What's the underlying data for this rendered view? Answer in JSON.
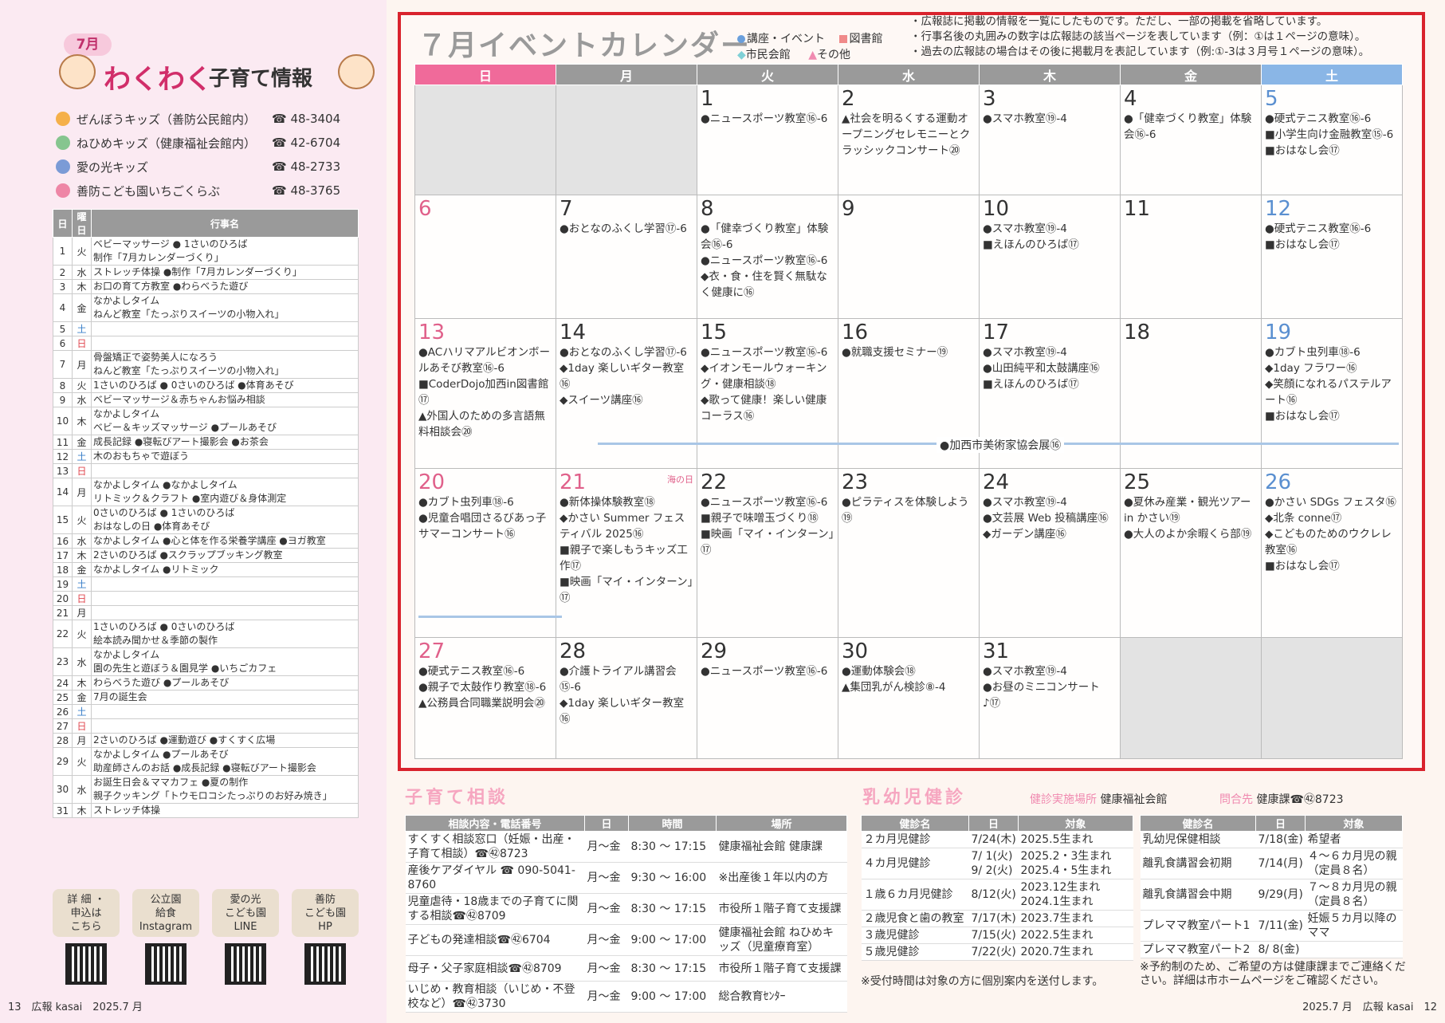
{
  "left": {
    "month_tag": "7月",
    "title_a": "わくわく",
    "title_b": "子育て情報",
    "contacts": [
      {
        "name": "ぜんぼうキッズ（善防公民館内）",
        "phone": "☎ 48-3404",
        "color": "#f5b04a"
      },
      {
        "name": "ねひめキッズ（健康福祉会館内）",
        "phone": "☎ 42-6704",
        "color": "#86c58f"
      },
      {
        "name": "愛の光キッズ",
        "phone": "☎ 48-2733",
        "color": "#7b9bd6"
      },
      {
        "name": "善防こども園いちごくらぶ",
        "phone": "☎ 48-3765",
        "color": "#ee86a6"
      }
    ],
    "schedule_headers": [
      "日",
      "曜日",
      "行事名"
    ],
    "schedule": [
      {
        "d": "1",
        "w": "火",
        "e": [
          "ベビーマッサージ ● 1さいのひろば",
          "制作「7月カレンダーづくり」"
        ]
      },
      {
        "d": "2",
        "w": "水",
        "e": [
          "ストレッチ体操 ●制作「7月カレンダーづくり」"
        ]
      },
      {
        "d": "3",
        "w": "木",
        "e": [
          "お口の育て方教室 ●わらべうた遊び"
        ]
      },
      {
        "d": "4",
        "w": "金",
        "e": [
          "なかよしタイム",
          "ねんど教室「たっぷりスイーツの小物入れ」"
        ]
      },
      {
        "d": "5",
        "w": "土",
        "e": []
      },
      {
        "d": "6",
        "w": "日",
        "e": []
      },
      {
        "d": "7",
        "w": "月",
        "e": [
          "骨盤矯正で姿勢美人になろう",
          "ねんど教室「たっぷりスイーツの小物入れ」"
        ]
      },
      {
        "d": "8",
        "w": "火",
        "e": [
          "1さいのひろば ● 0さいのひろば ●体育あそび"
        ]
      },
      {
        "d": "9",
        "w": "水",
        "e": [
          "ベビーマッサージ＆赤ちゃんお悩み相談"
        ]
      },
      {
        "d": "10",
        "w": "木",
        "e": [
          "なかよしタイム",
          "ベビー＆キッズマッサージ ●プールあそび"
        ]
      },
      {
        "d": "11",
        "w": "金",
        "e": [
          "成長記録 ●寝転びアート撮影会 ●お茶会"
        ]
      },
      {
        "d": "12",
        "w": "土",
        "e": [
          "木のおもちゃで遊ぼう"
        ]
      },
      {
        "d": "13",
        "w": "日",
        "e": []
      },
      {
        "d": "14",
        "w": "月",
        "e": [
          "なかよしタイム ●なかよしタイム",
          "リトミック＆クラフト ●室内遊び＆身体測定"
        ]
      },
      {
        "d": "15",
        "w": "火",
        "e": [
          "0さいのひろば ● 1さいのひろば",
          "おはなしの日 ●体育あそび"
        ]
      },
      {
        "d": "16",
        "w": "水",
        "e": [
          "なかよしタイム ●心と体を作る栄養学講座 ●ヨガ教室"
        ]
      },
      {
        "d": "17",
        "w": "木",
        "e": [
          "2さいのひろば ●スクラップブッキング教室"
        ]
      },
      {
        "d": "18",
        "w": "金",
        "e": [
          "なかよしタイム ●リトミック"
        ]
      },
      {
        "d": "19",
        "w": "土",
        "e": []
      },
      {
        "d": "20",
        "w": "日",
        "e": []
      },
      {
        "d": "21",
        "w": "月",
        "e": []
      },
      {
        "d": "22",
        "w": "火",
        "e": [
          "1さいのひろば ● 0さいのひろば",
          "絵本読み聞かせ＆季節の製作"
        ]
      },
      {
        "d": "23",
        "w": "水",
        "e": [
          "なかよしタイム",
          "園の先生と遊ぼう＆園見学 ●いちごカフェ"
        ]
      },
      {
        "d": "24",
        "w": "木",
        "e": [
          "わらべうた遊び ●プールあそび"
        ]
      },
      {
        "d": "25",
        "w": "金",
        "e": [
          "7月の誕生会"
        ]
      },
      {
        "d": "26",
        "w": "土",
        "e": []
      },
      {
        "d": "27",
        "w": "日",
        "e": []
      },
      {
        "d": "28",
        "w": "月",
        "e": [
          "2さいのひろば ●運動遊び ●すくすく広場"
        ]
      },
      {
        "d": "29",
        "w": "火",
        "e": [
          "なかよしタイム ●プールあそび",
          "助産師さんのお話 ●成長記録 ●寝転びアート撮影会"
        ]
      },
      {
        "d": "30",
        "w": "水",
        "e": [
          "お誕生日会＆ママカフェ ●夏の制作",
          "親子クッキング「トウモロコシたっぷりのお好み焼き」"
        ]
      },
      {
        "d": "31",
        "w": "木",
        "e": [
          "ストレッチ体操"
        ]
      }
    ],
    "links": [
      "詳 細 ・\n申込は\nこちら",
      "公立園\n給食\nInstagram",
      "愛の光\nこども園\nLINE",
      "善防\nこども園\nHP"
    ],
    "footer": "13　広報 kasai　2025.7 月"
  },
  "calendar": {
    "title": "７月イベントカレンダー",
    "legend": [
      "講座・イベント",
      "市民会館",
      "図書館",
      "その他"
    ],
    "notes": [
      "・広報誌に掲載の情報を一覧にしたものです。ただし、一部の掲載を省略しています。",
      "・行事名後の丸囲みの数字は広報誌の該当ページを表しています（例：①は１ページの意味）。",
      "・過去の広報誌の場合はその後に掲載月を表記しています（例:①-3は３月号１ページの意味）。"
    ],
    "weekdays": [
      "日",
      "月",
      "火",
      "水",
      "木",
      "金",
      "土"
    ],
    "weeks": [
      [
        {
          "n": "",
          "g": true,
          "ev": []
        },
        {
          "n": "",
          "g": true,
          "ev": []
        },
        {
          "n": "1",
          "ev": [
            "●ニュースポーツ教室⑯-6"
          ]
        },
        {
          "n": "2",
          "ev": [
            "▲社会を明るくする運動オープニングセレモニーとクラッシックコンサート⑳"
          ]
        },
        {
          "n": "3",
          "ev": [
            "●スマホ教室⑲-4"
          ]
        },
        {
          "n": "4",
          "ev": [
            "●「健幸づくり教室」体験会⑯-6"
          ]
        },
        {
          "n": "5",
          "ev": [
            "●硬式テニス教室⑯-6",
            "■小学生向け金融教室⑮-6",
            "■おはなし会⑰"
          ]
        }
      ],
      [
        {
          "n": "6",
          "ev": []
        },
        {
          "n": "7",
          "ev": [
            "●おとなのふくし学習⑰-6"
          ]
        },
        {
          "n": "8",
          "ev": [
            "●「健幸づくり教室」体験会⑯-6",
            "●ニュースポーツ教室⑯-6",
            "◆衣・食・住を賢く無駄なく健康に⑯"
          ]
        },
        {
          "n": "9",
          "ev": []
        },
        {
          "n": "10",
          "ev": [
            "●スマホ教室⑲-4",
            "■えほんのひろば⑰"
          ]
        },
        {
          "n": "11",
          "ev": []
        },
        {
          "n": "12",
          "ev": [
            "●硬式テニス教室⑯-6",
            "■おはなし会⑰"
          ]
        }
      ],
      [
        {
          "n": "13",
          "ev": [
            "●ACハリマアルビオンボールあそび教室⑯-6",
            "■CoderDojo加西in図書館⑰",
            "▲外国人のための多言語無料相談会⑳"
          ]
        },
        {
          "n": "14",
          "ev": [
            "●おとなのふくし学習⑰-6",
            "◆1day 楽しいギター教室⑯",
            "◆スイーツ講座⑯"
          ]
        },
        {
          "n": "15",
          "ev": [
            "●ニュースポーツ教室⑯-6",
            "◆イオンモールウォーキング・健康相談⑱",
            "◆歌って健康！楽しい健康コーラス⑯"
          ]
        },
        {
          "n": "16",
          "ev": [
            "●就職支援セミナー⑲"
          ]
        },
        {
          "n": "17",
          "ev": [
            "●スマホ教室⑲-4",
            "●山田純平和太鼓講座⑯",
            "■えほんのひろば⑰"
          ]
        },
        {
          "n": "18",
          "ev": []
        },
        {
          "n": "19",
          "ev": [
            "●カブト虫列車⑱-6",
            "◆1day フラワー⑯",
            "◆笑顔になれるパステルアート⑯",
            "■おはなし会⑰"
          ]
        }
      ],
      [
        {
          "n": "20",
          "ev": [
            "●カブト虫列車⑱-6",
            "●児童合唱団さるびあっ子サマーコンサート⑯"
          ]
        },
        {
          "n": "21",
          "holiday": "海の日",
          "ev": [
            "●新体操体験教室⑱",
            "◆かさい Summer フェスティバル 2025⑯",
            "■親子で楽しもうキッズ工作⑰",
            "■映画「マイ・インターン」⑰"
          ]
        },
        {
          "n": "22",
          "ev": [
            "●ニュースポーツ教室⑯-6",
            "■親子で味噌玉づくり⑱",
            "■映画「マイ・インターン」⑰"
          ]
        },
        {
          "n": "23",
          "ev": [
            "●ピラティスを体験しよう⑲"
          ]
        },
        {
          "n": "24",
          "ev": [
            "●スマホ教室⑲-4",
            "●文芸展 Web 投稿講座⑯",
            "◆ガーデン講座⑯"
          ]
        },
        {
          "n": "25",
          "ev": [
            "●夏休み産業・観光ツアー in かさい⑲",
            "●大人のよか余暇くら部⑲"
          ]
        },
        {
          "n": "26",
          "ev": [
            "●かさい SDGs フェスタ⑯",
            "◆北条 conne⑰",
            "◆こどものためのウクレレ教室⑯",
            "■おはなし会⑰"
          ]
        }
      ],
      [
        {
          "n": "27",
          "ev": [
            "●硬式テニス教室⑯-6",
            "●親子で太鼓作り教室⑱-6",
            "▲公務員合同職業説明会⑳"
          ]
        },
        {
          "n": "28",
          "ev": [
            "●介護トライアル講習会⑮-6",
            "◆1day 楽しいギター教室⑯"
          ]
        },
        {
          "n": "29",
          "ev": [
            "●ニュースポーツ教室⑯-6"
          ]
        },
        {
          "n": "30",
          "ev": [
            "●運動体験会⑱",
            "▲集団乳がん検診⑧-4"
          ]
        },
        {
          "n": "31",
          "ev": [
            "●スマホ教室⑲-4",
            "●お昼のミニコンサート♪⑰"
          ]
        },
        {
          "n": "",
          "g": true,
          "ev": []
        },
        {
          "n": "",
          "g": true,
          "ev": []
        }
      ]
    ],
    "exhibit": "●加西市美術家協会展⑯"
  },
  "soudan": {
    "title": "子育て相談",
    "headers": [
      "相談内容・電話番号",
      "日",
      "時間",
      "場所"
    ],
    "rows": [
      [
        "すくすく相談窓口（妊娠・出産・子育て相談）☎㊷8723",
        "月〜金",
        "8:30 〜 17:15",
        "健康福祉会館 健康課"
      ],
      [
        "産後ケアダイヤル ☎ 090-5041-8760",
        "月〜金",
        "9:30 〜 16:00",
        "※出産後１年以内の方"
      ],
      [
        "児童虐待・18歳までの子育てに関する相談☎㊷8709",
        "月〜金",
        "8:30 〜 17:15",
        "市役所１階子育て支援課"
      ],
      [
        "子どもの発達相談☎㊷6704",
        "月〜金",
        "9:00 〜 17:00",
        "健康福祉会館 ねひめキッズ（児童療育室）"
      ],
      [
        "母子・父子家庭相談☎㊷8709",
        "月〜金",
        "8:30 〜 17:15",
        "市役所１階子育て支援課"
      ],
      [
        "いじめ・教育相談（いじめ・不登校など）☎㊷3730",
        "月〜金",
        "9:00 〜 17:00",
        "総合教育ｾﾝﾀｰ"
      ]
    ]
  },
  "kenshin": {
    "title": "乳幼児健診",
    "place_label": "健診実施場所",
    "place": "健康福祉会館",
    "contact_label": "問合先",
    "contact": "健康課☎㊷8723",
    "headers_a": [
      "健診名",
      "日",
      "対象"
    ],
    "rows_a": [
      [
        "２カ月児健診",
        "7/24(木)",
        "2025.5生まれ"
      ],
      [
        "４カ月児健診",
        "7/ 1(火)　9/ 2(火)",
        "2025.2・3生まれ　2025.4・5生まれ"
      ],
      [
        "１歳６カ月児健診",
        "8/12(火)",
        "2023.12生まれ　2024.1生まれ"
      ],
      [
        "２歳児食と歯の教室",
        "7/17(木)",
        "2023.7生まれ"
      ],
      [
        "３歳児健診",
        "7/15(火)",
        "2022.5生まれ"
      ],
      [
        "５歳児健診",
        "7/22(火)",
        "2020.7生まれ"
      ]
    ],
    "headers_b": [
      "健診名",
      "日",
      "対象"
    ],
    "rows_b": [
      [
        "乳幼児保健相談",
        "7/18(金)",
        "希望者"
      ],
      [
        "離乳食講習会初期",
        "7/14(月)",
        "４〜６カ月児の親（定員８名）"
      ],
      [
        "離乳食講習会中期",
        "9/29(月)",
        "７〜８カ月児の親（定員８名）"
      ],
      [
        "プレママ教室パート1",
        "7/11(金)",
        "妊娠５カ月以降のママ"
      ],
      [
        "プレママ教室パート2",
        "8/ 8(金)",
        ""
      ]
    ],
    "note_a": "※受付時間は対象の方に個別案内を送付します。",
    "note_b": "※予約制のため、ご希望の方は健康課までご連絡ください。詳細は市ホームページをご確認ください。"
  },
  "footer_right": "2025.7 月　広報 kasai　12",
  "colors": {
    "sun": "#f06a9a",
    "weekday": "#9a9a9a",
    "sat": "#8ab6e6",
    "accent": "#d12e6a",
    "frame": "#d9232d"
  }
}
